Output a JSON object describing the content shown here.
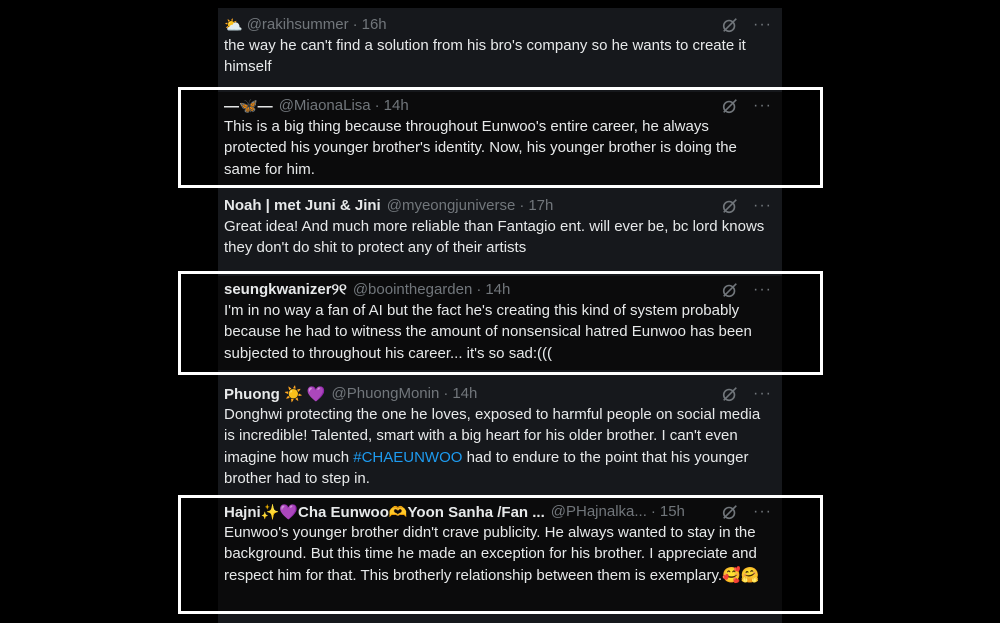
{
  "tweets": [
    {
      "name": "",
      "avatar_emoji": "⛅",
      "handle": "@rakihsummer",
      "time": "16h",
      "text": "the way he can't find a solution from his bro's company so he wants to create it himself"
    },
    {
      "name": "—🦋—",
      "handle": "@MiaonaLisa",
      "time": "14h",
      "text": "This is a big thing because throughout Eunwoo's entire career, he always protected his younger brother's identity. Now, his younger brother is doing the same for him."
    },
    {
      "name": "Noah | met Juni & Jini",
      "handle": "@myeongjuniverse",
      "time": "17h",
      "text": "Great idea! And much more reliable than Fantagio ent. will ever be, bc lord knows they don't do shit to protect any of their artists"
    },
    {
      "name": "seungkwanizer୨୧",
      "handle": "@boointhegarden",
      "time": "14h",
      "text": "I'm in no way a fan of AI but the fact he's creating this kind of system probably because he had to witness the amount of nonsensical hatred Eunwoo has been subjected to throughout his career... it's so sad:((("
    },
    {
      "name": "Phuong ☀️ 💜",
      "handle": "@PhuongMonin",
      "time": "14h",
      "text_before": "Donghwi protecting the one he loves, exposed to harmful people on social media is incredible! Talented, smart with a big heart for his older brother. I can't even imagine how much ",
      "hashtag": "#CHAEUNWOO",
      "text_after": " had to endure to the point that his younger brother had to step in."
    },
    {
      "name": "Hajni✨💜Cha Eunwoo🫶Yoon Sanha /Fan ...",
      "handle": "@PHajnalka...",
      "time": "15h",
      "text": "Eunwoo's younger brother didn't crave publicity. He always wanted to stay in the background. But this time he made an exception for his brother. I appreciate and respect him for that. This brotherly relationship between them is exemplary.🥰🤗"
    }
  ],
  "separator": "·",
  "more_label": "···",
  "colors": {
    "background": "#000000",
    "card": "#16181c",
    "text": "#e7e9ea",
    "muted": "#71767b",
    "link": "#1d9bf0",
    "highlight_border": "#ffffff"
  }
}
